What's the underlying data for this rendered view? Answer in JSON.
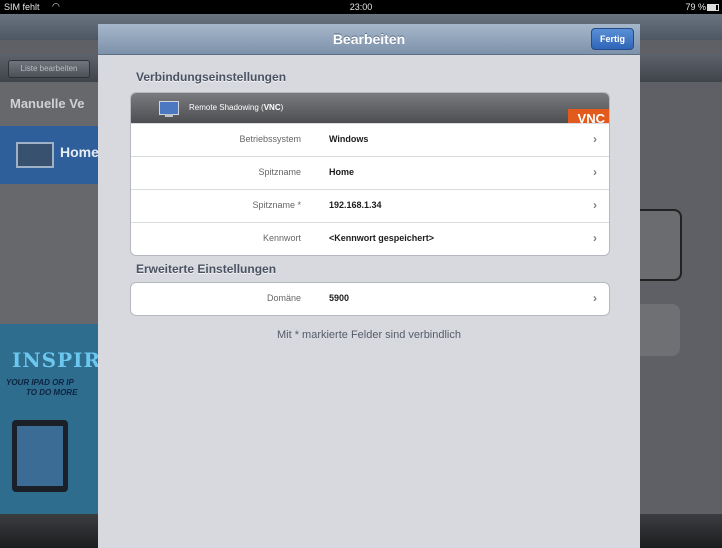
{
  "status_bar": {
    "carrier": "SIM fehlt",
    "time": "23:00",
    "battery": "79 %"
  },
  "background": {
    "edit_list_label": "Liste bearbeiten",
    "section_title": "Manuelle Ve",
    "home_label": "Home",
    "promo_title": "INSPIR",
    "promo_line1": "YOUR IPAD OR IP",
    "promo_line2": "TO DO MORE"
  },
  "modal": {
    "title": "Bearbeiten",
    "done_label": "Fertig",
    "section1_title": "Verbindungseinstellungen",
    "connection_header": {
      "prefix": "Remote Shadowing (",
      "bold": "VNC",
      "suffix": ")",
      "badge": "VNC"
    },
    "rows": [
      {
        "label": "Betriebssystem",
        "value": "Windows"
      },
      {
        "label": "Spitzname",
        "value": "Home"
      },
      {
        "label": "Spitzname *",
        "value": "192.168.1.34"
      },
      {
        "label": "Kennwort",
        "value": "<Kennwort gespeichert>"
      }
    ],
    "section2_title": "Erweiterte Einstellungen",
    "advanced_rows": [
      {
        "label": "Domäne",
        "value": "5900"
      }
    ],
    "footnote": "Mit * markierte Felder sind verbindlich"
  }
}
